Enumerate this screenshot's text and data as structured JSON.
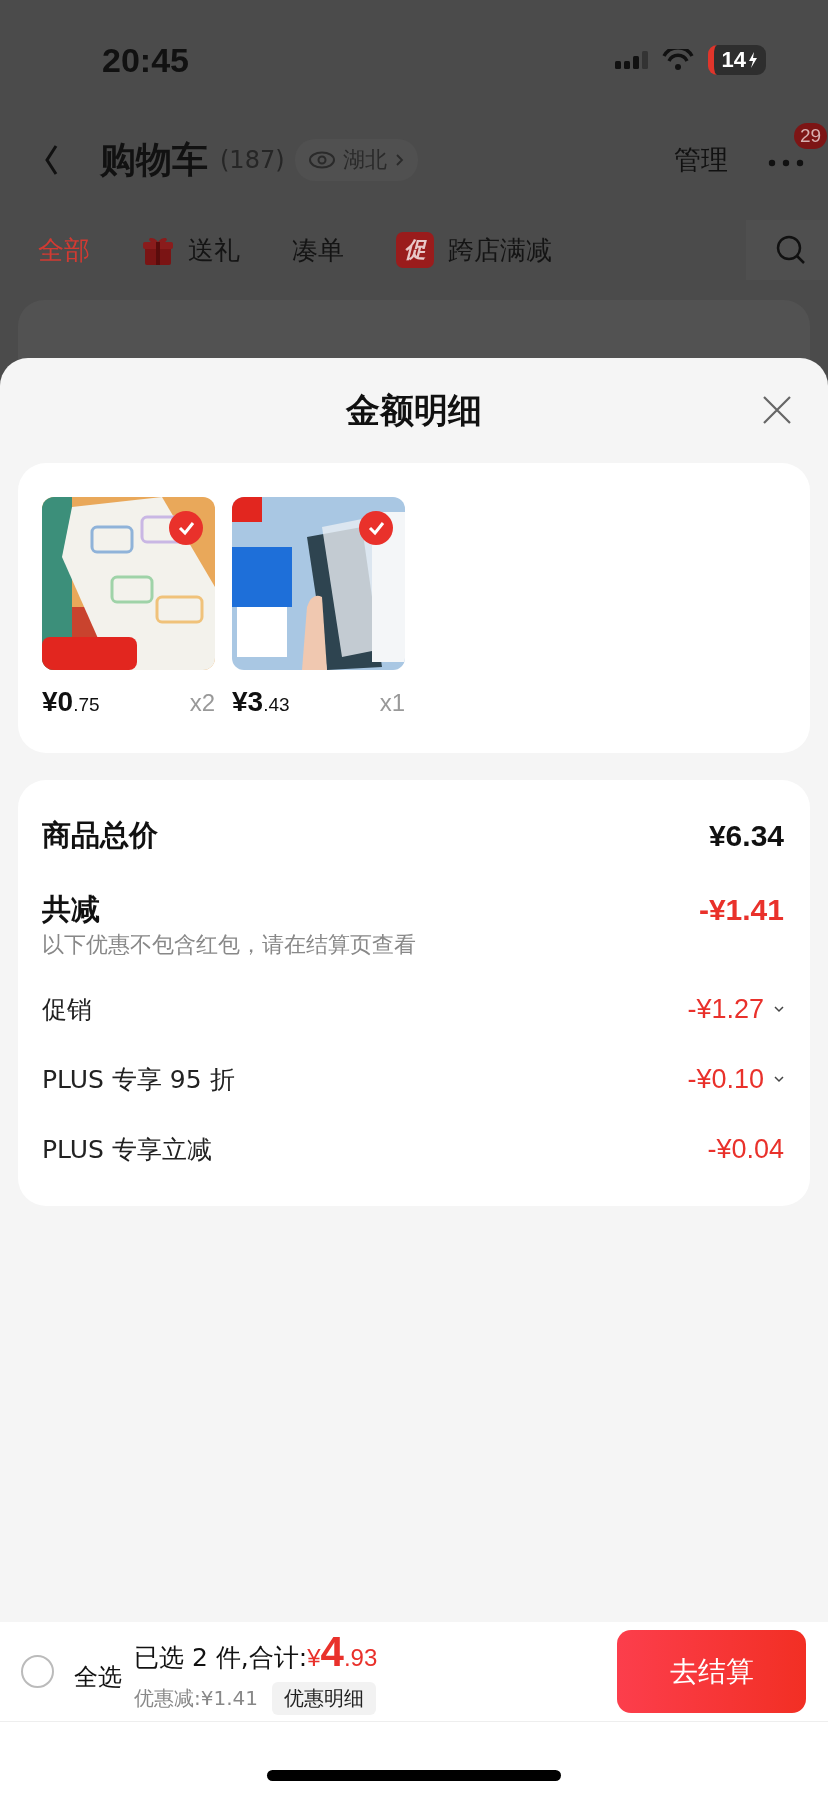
{
  "status_bar": {
    "time": "20:45",
    "battery": "14"
  },
  "nav": {
    "title": "购物车",
    "count": "(187)",
    "location": "湖北",
    "manage": "管理",
    "badge": "29"
  },
  "tabs": [
    {
      "label": "全部",
      "selected": true,
      "kind": "plain"
    },
    {
      "label": "送礼",
      "selected": false,
      "kind": "gift"
    },
    {
      "label": "凑单",
      "selected": false,
      "kind": "plain"
    },
    {
      "label": "跨店满减",
      "selected": false,
      "kind": "promo",
      "icon_text": "促"
    }
  ],
  "sheet": {
    "title": "金额明细",
    "products": [
      {
        "price": "¥0.75",
        "quantity": "x2",
        "checked": true
      },
      {
        "price": "¥3.43",
        "quantity": "x1",
        "checked": true
      }
    ],
    "rows": [
      {
        "kind": "total",
        "label": "商品总价",
        "amount": "¥6.34"
      },
      {
        "kind": "discount",
        "label": "共减",
        "amount": "-¥1.41",
        "note": "以下优惠不包含红包，请在结算页查看"
      },
      {
        "kind": "item",
        "label": "促销",
        "amount": "-¥1.27",
        "expandable": true
      },
      {
        "kind": "item",
        "label": "PLUS 专享 95 折",
        "amount": "-¥0.10",
        "expandable": true
      },
      {
        "kind": "item",
        "label": "PLUS 专享立减",
        "amount": "-¥0.04",
        "expandable": false
      }
    ]
  },
  "footer": {
    "select_all": "全选",
    "checked": false,
    "summary": "已选 2 件,合计:",
    "total": "¥4.93",
    "saving": "优惠减:¥1.41",
    "details": "优惠明细",
    "checkout": "去结算"
  }
}
